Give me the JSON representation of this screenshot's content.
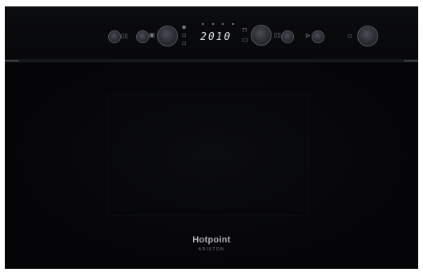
{
  "display": {
    "time": "2010"
  },
  "panel": {
    "icons": [
      "small-knob-icon",
      "grill-icon",
      "small-knob-icon",
      "oven-icon",
      "large-knob-icon",
      "function-symbol-icon",
      "large-knob-icon",
      "power-symbol-icon",
      "small-knob-icon",
      "small-knob-icon",
      "fan-symbol-icon",
      "large-knob-icon"
    ]
  },
  "brand": {
    "name": "Hotpoint",
    "sub": "ARISTON"
  },
  "colors": {
    "body": "#050506",
    "display_text": "#d8dbe2",
    "knob": "#2a2c32",
    "brand_text": "#aeb2ba"
  }
}
